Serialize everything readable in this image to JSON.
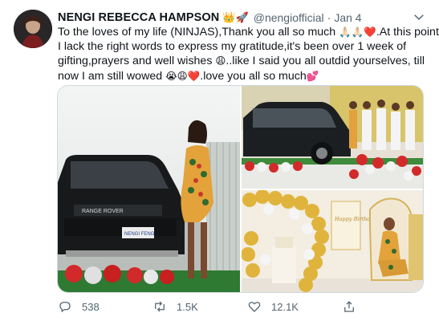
{
  "tweet": {
    "author": {
      "name": "NENGI REBECCA HAMPSON",
      "emoji": "👑🚀",
      "handle": "@nengiofficial",
      "separator": "·",
      "date": "Jan 4"
    },
    "text_lines": [
      "To the loves of my life (NINJAS),Thank you all so much",
      ".At this point",
      "I lack the right words to express my gratitude,it's been over 1 week of",
      "gifting,prayers and well wishes",
      "..like I said you all outdid yourselves, till",
      "now I am still wowed",
      ".love you all so much"
    ],
    "emojis": {
      "thanks": "🙏🏻🙏🏻❤️",
      "tired": "😩",
      "wowed": "😭😩❤️",
      "heart": "💕"
    },
    "media": {
      "car_plate": "NENGI FENG",
      "car_brand": "RANGE ROVER",
      "sign_text": "Happy Birthday Nengi"
    },
    "actions": {
      "replies": "538",
      "retweets": "1.5K",
      "likes": "12.1K"
    }
  }
}
